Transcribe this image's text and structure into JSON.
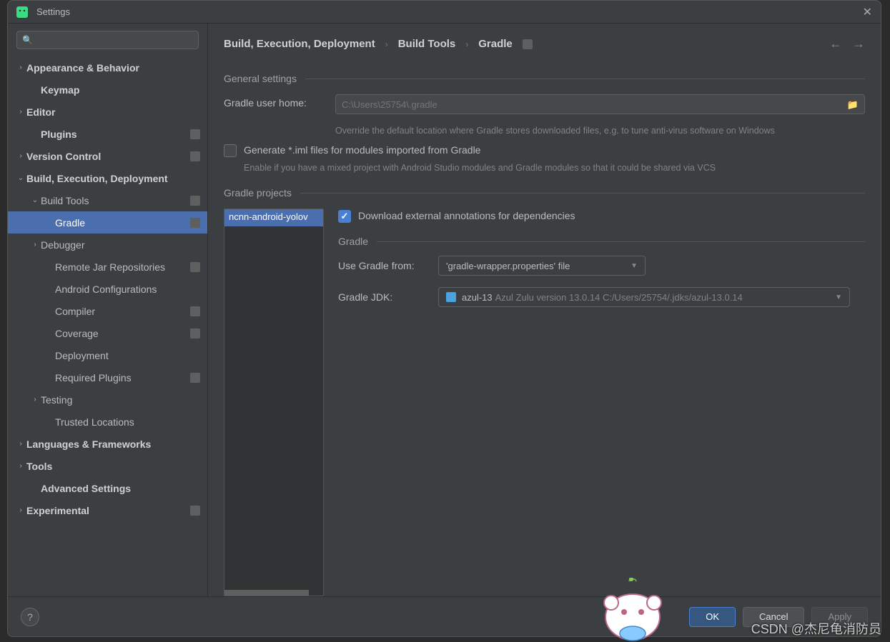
{
  "titlebar": {
    "title": "Settings"
  },
  "search": {
    "placeholder": ""
  },
  "sidebar": {
    "items": [
      {
        "label": "Appearance & Behavior",
        "depth": 0,
        "arrow": ">",
        "bold": true
      },
      {
        "label": "Keymap",
        "depth": 1,
        "arrow": "",
        "bold": true
      },
      {
        "label": "Editor",
        "depth": 0,
        "arrow": ">",
        "bold": true
      },
      {
        "label": "Plugins",
        "depth": 1,
        "arrow": "",
        "bold": true,
        "badge": true
      },
      {
        "label": "Version Control",
        "depth": 0,
        "arrow": ">",
        "bold": true,
        "badge": true
      },
      {
        "label": "Build, Execution, Deployment",
        "depth": 0,
        "arrow": "v",
        "bold": true
      },
      {
        "label": "Build Tools",
        "depth": 1,
        "arrow": "v",
        "bold": false,
        "badge": true
      },
      {
        "label": "Gradle",
        "depth": 2,
        "arrow": "",
        "bold": false,
        "badge": true,
        "selected": true
      },
      {
        "label": "Debugger",
        "depth": 1,
        "arrow": ">",
        "bold": false
      },
      {
        "label": "Remote Jar Repositories",
        "depth": 2,
        "arrow": "",
        "bold": false,
        "badge": true
      },
      {
        "label": "Android Configurations",
        "depth": 2,
        "arrow": "",
        "bold": false
      },
      {
        "label": "Compiler",
        "depth": 2,
        "arrow": "",
        "bold": false,
        "badge": true
      },
      {
        "label": "Coverage",
        "depth": 2,
        "arrow": "",
        "bold": false,
        "badge": true
      },
      {
        "label": "Deployment",
        "depth": 2,
        "arrow": "",
        "bold": false
      },
      {
        "label": "Required Plugins",
        "depth": 2,
        "arrow": "",
        "bold": false,
        "badge": true
      },
      {
        "label": "Testing",
        "depth": 1,
        "arrow": ">",
        "bold": false
      },
      {
        "label": "Trusted Locations",
        "depth": 2,
        "arrow": "",
        "bold": false
      },
      {
        "label": "Languages & Frameworks",
        "depth": 0,
        "arrow": ">",
        "bold": true
      },
      {
        "label": "Tools",
        "depth": 0,
        "arrow": ">",
        "bold": true
      },
      {
        "label": "Advanced Settings",
        "depth": 1,
        "arrow": "",
        "bold": true
      },
      {
        "label": "Experimental",
        "depth": 0,
        "arrow": ">",
        "bold": true,
        "badge": true
      }
    ]
  },
  "breadcrumbs": [
    "Build, Execution, Deployment",
    "Build Tools",
    "Gradle"
  ],
  "general": {
    "title": "General settings",
    "user_home_label": "Gradle user home:",
    "user_home_placeholder": "C:\\Users\\25754\\.gradle",
    "user_home_hint": "Override the default location where Gradle stores downloaded files, e.g. to tune anti-virus software on Windows",
    "generate_iml_label": "Generate *.iml files for modules imported from Gradle",
    "generate_iml_hint": "Enable if you have a mixed project with Android Studio modules and Gradle modules so that it could be shared via VCS"
  },
  "projects": {
    "title": "Gradle projects",
    "items": [
      "ncnn-android-yolov"
    ],
    "download_annotations_label": "Download external annotations for dependencies",
    "gradle_section": "Gradle",
    "use_gradle_from_label": "Use Gradle from:",
    "use_gradle_from_value": "'gradle-wrapper.properties' file",
    "gradle_jdk_label": "Gradle JDK:",
    "gradle_jdk_name": "azul-13",
    "gradle_jdk_path": "Azul Zulu version 13.0.14 C:/Users/25754/.jdks/azul-13.0.14"
  },
  "footer": {
    "ok": "OK",
    "cancel": "Cancel",
    "apply": "Apply"
  },
  "watermark": "CSDN @杰尼龟消防员"
}
